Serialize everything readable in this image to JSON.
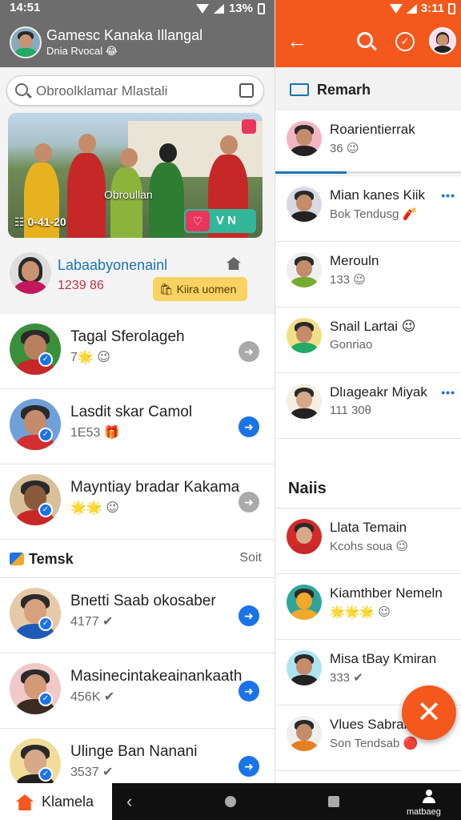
{
  "left": {
    "status": {
      "time": "14:51",
      "battery": "13%"
    },
    "header": {
      "title": "Gamesc Kanaka Illangal",
      "subtitle": "Dnia Rvocal 😂"
    },
    "search": {
      "placeholder": "Obroolklamar Mlastali"
    },
    "story": {
      "caption": "Obroullan",
      "time": "☷ 0-41-20"
    },
    "profile": {
      "name": "Labaabyonenainl",
      "count": "1239 86",
      "tag": "🛍 Kiira uomen"
    },
    "contacts": [
      {
        "name": "Tagal Sferolageh",
        "sub": "7🌟 😉",
        "shirt": "#c62828",
        "skin": "#b98060",
        "bg": "#3a8f3a",
        "go": "grey"
      },
      {
        "name": "Lasdit skar Camol",
        "sub": "1E53 🎁",
        "shirt": "#d32f2f",
        "skin": "#c48c6a",
        "bg": "#6fa1d8",
        "go": "blue"
      },
      {
        "name": "Mayntiay bradar Kakama",
        "sub": "🌟🌟 😉",
        "shirt": "#c62828",
        "skin": "#8a5a3c",
        "bg": "#d8c09a",
        "go": "grey"
      }
    ],
    "teams": {
      "title": "Temsk",
      "sort": "Soit"
    },
    "teams_rows": [
      {
        "name": "Bnetti Saab okosaber",
        "sub": "4177 ✔",
        "shirt": "#1e5ab8",
        "skin": "#d7a07e",
        "bg": "#e6c9a8",
        "go": "blue"
      },
      {
        "name": "Masinecintakeainankaath",
        "sub": "456K ✔",
        "shirt": "#3b2a1f",
        "skin": "#d39a78",
        "bg": "#f1c9c9",
        "go": "blue"
      },
      {
        "name": "Ulinge Ban Nanani",
        "sub": "3537 ✔",
        "shirt": "#222",
        "skin": "#d6a98a",
        "bg": "#f2dc9a",
        "go": "blue"
      }
    ]
  },
  "right": {
    "status": {
      "time": "3:11"
    },
    "section_title": "Remarh",
    "progress": 0.38,
    "conversations": [
      {
        "name": "Roarientierrak",
        "sub": "36 😉",
        "skin": "#c48c6a",
        "shirt": "#222",
        "bg": "#f3b5c4",
        "more": false
      },
      {
        "name": "Mian kanes Kiik",
        "sub": "Bok Tendusg 🧨",
        "skin": "#c48c6a",
        "shirt": "#222",
        "bg": "#d9d9e6",
        "more": true
      },
      {
        "name": "Merouln",
        "sub": "133 😉",
        "skin": "#c48c6a",
        "shirt": "#7a3",
        "bg": "#eee",
        "more": false
      },
      {
        "name": "Snail Lartai 😉",
        "sub": "Gonriao",
        "skin": "#c48c6a",
        "shirt": "#2a6",
        "bg": "#f1df88",
        "more": false
      },
      {
        "name": "Dlıageakr Miyak",
        "sub": "111 30θ",
        "skin": "#d6a98a",
        "shirt": "#222",
        "bg": "#f5efe3",
        "more": true
      }
    ],
    "nais_title": "Naiis",
    "nais": [
      {
        "name": "Llata Temain",
        "sub": "Kcohs soua 😉",
        "skin": "#d6a98a",
        "shirt": "#c62828",
        "bg": "#d42a2a",
        "more": false
      },
      {
        "name": "Kiamthber Nemeln",
        "sub": "🌟🌟🌟 😉",
        "skin": "#f2a82b",
        "shirt": "#f2a82b",
        "bg": "#2fa59a",
        "more": false
      },
      {
        "name": "Misa tBay Kmiran",
        "sub": "333 ✔",
        "skin": "#c48c6a",
        "shirt": "#222",
        "bg": "#aee4f2",
        "more": false
      },
      {
        "name": "Vlues Sabral S",
        "sub": "Son Tendsab 🔴",
        "skin": "#c48c6a",
        "shirt": "#e67e22",
        "bg": "#eee",
        "more": false
      }
    ]
  },
  "fab": {
    "symbol": "✕"
  },
  "bottom_nav": {
    "home_label": "Klamela",
    "profile_label": "matbaeg",
    "back_symbol": "‹"
  },
  "colors": {
    "accent": "#f4581d",
    "link": "#1a73e8",
    "header_grey": "#6d6d6d"
  }
}
